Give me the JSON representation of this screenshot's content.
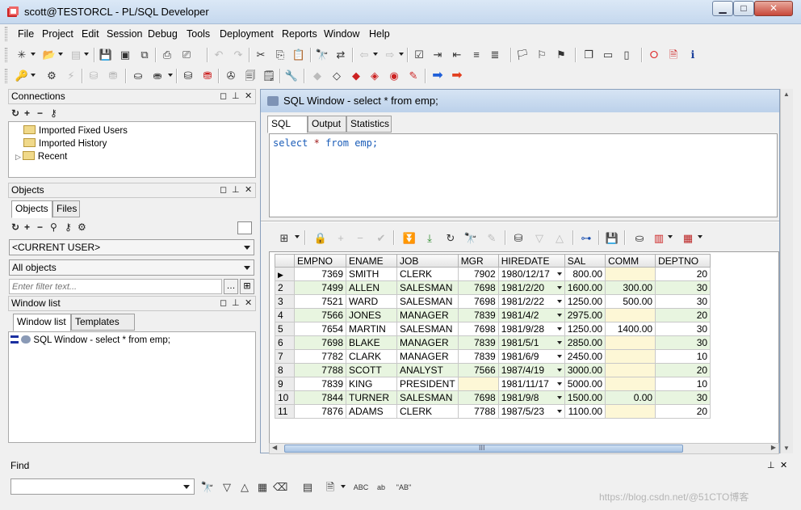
{
  "window": {
    "title": "scott@TESTORCL - PL/SQL Developer",
    "minimize": "▁",
    "maximize": "□",
    "close": "✕"
  },
  "menu": [
    "File",
    "Project",
    "Edit",
    "Session",
    "Debug",
    "Tools",
    "Deployment",
    "Reports",
    "Window",
    "Help"
  ],
  "connections": {
    "title": "Connections",
    "items": [
      "Imported Fixed Users",
      "Imported History",
      "Recent"
    ]
  },
  "objects": {
    "title": "Objects",
    "tabs": [
      "Objects",
      "Files"
    ],
    "user_combo": "<CURRENT USER>",
    "type_combo": "All objects",
    "filter_placeholder": "Enter filter text..."
  },
  "window_list": {
    "title": "Window list",
    "tabs": [
      "Window list",
      "Templates"
    ],
    "items": [
      "SQL Window - select * from emp;"
    ]
  },
  "sql_window": {
    "title": "SQL Window - select * from emp;",
    "tabs": [
      "SQL",
      "Output",
      "Statistics"
    ],
    "query": {
      "kw1": "select",
      "op": "*",
      "kw2": "from",
      "table": "emp;"
    }
  },
  "grid": {
    "columns": [
      "EMPNO",
      "ENAME",
      "JOB",
      "MGR",
      "HIREDATE",
      "SAL",
      "COMM",
      "DEPTNO"
    ],
    "rows": [
      [
        "1",
        "7369",
        "SMITH",
        "CLERK",
        "7902",
        "1980/12/17",
        "800.00",
        "",
        "20"
      ],
      [
        "2",
        "7499",
        "ALLEN",
        "SALESMAN",
        "7698",
        "1981/2/20",
        "1600.00",
        "300.00",
        "30"
      ],
      [
        "3",
        "7521",
        "WARD",
        "SALESMAN",
        "7698",
        "1981/2/22",
        "1250.00",
        "500.00",
        "30"
      ],
      [
        "4",
        "7566",
        "JONES",
        "MANAGER",
        "7839",
        "1981/4/2",
        "2975.00",
        "",
        "20"
      ],
      [
        "5",
        "7654",
        "MARTIN",
        "SALESMAN",
        "7698",
        "1981/9/28",
        "1250.00",
        "1400.00",
        "30"
      ],
      [
        "6",
        "7698",
        "BLAKE",
        "MANAGER",
        "7839",
        "1981/5/1",
        "2850.00",
        "",
        "30"
      ],
      [
        "7",
        "7782",
        "CLARK",
        "MANAGER",
        "7839",
        "1981/6/9",
        "2450.00",
        "",
        "10"
      ],
      [
        "8",
        "7788",
        "SCOTT",
        "ANALYST",
        "7566",
        "1987/4/19",
        "3000.00",
        "",
        "20"
      ],
      [
        "9",
        "7839",
        "KING",
        "PRESIDENT",
        "",
        "1981/11/17",
        "5000.00",
        "",
        "10"
      ],
      [
        "10",
        "7844",
        "TURNER",
        "SALESMAN",
        "7698",
        "1981/9/8",
        "1500.00",
        "0.00",
        "30"
      ],
      [
        "11",
        "7876",
        "ADAMS",
        "CLERK",
        "7788",
        "1987/5/23",
        "1100.00",
        "",
        "20"
      ]
    ],
    "scroll_grip": "III"
  },
  "find": {
    "title": "Find",
    "abc1": "ABC",
    "abc2": "ab",
    "abc3": "\"AB\""
  },
  "watermark": "https://blog.csdn.net/@51CTO博客",
  "colors": {
    "row_even": "#e8f5e0",
    "null_cell": "#fdf7d6",
    "title_blue": "#bcd1ea"
  }
}
